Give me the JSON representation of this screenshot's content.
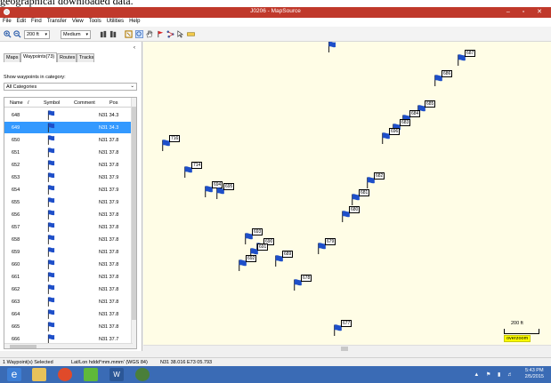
{
  "caption": "geographical downloaded data.",
  "window": {
    "title": "J0206 - MapSource"
  },
  "menu": [
    "File",
    "Edit",
    "Find",
    "Transfer",
    "View",
    "Tools",
    "Utilities",
    "Help"
  ],
  "toolbar": {
    "zoom_level": "200 ft",
    "detail": "Medium"
  },
  "tabs": [
    "Maps",
    "Waypoints(73)",
    "Routes",
    "Tracks"
  ],
  "panel": {
    "show_label": "Show waypoints in category:",
    "category": "All Categories",
    "columns": [
      "Name",
      "/",
      "Symbol",
      "Comment",
      "Pos"
    ]
  },
  "waypoints": [
    {
      "name": "648",
      "pos": "N31 34.3"
    },
    {
      "name": "649",
      "pos": "N31 34.3"
    },
    {
      "name": "650",
      "pos": "N31 37.8"
    },
    {
      "name": "651",
      "pos": "N31 37.8"
    },
    {
      "name": "652",
      "pos": "N31 37.8"
    },
    {
      "name": "653",
      "pos": "N31 37.9"
    },
    {
      "name": "654",
      "pos": "N31 37.9"
    },
    {
      "name": "655",
      "pos": "N31 37.9"
    },
    {
      "name": "656",
      "pos": "N31 37.8"
    },
    {
      "name": "657",
      "pos": "N31 37.8"
    },
    {
      "name": "658",
      "pos": "N31 37.8"
    },
    {
      "name": "659",
      "pos": "N31 37.8"
    },
    {
      "name": "660",
      "pos": "N31 37.8"
    },
    {
      "name": "661",
      "pos": "N31 37.8"
    },
    {
      "name": "662",
      "pos": "N31 37.8"
    },
    {
      "name": "663",
      "pos": "N31 37.8"
    },
    {
      "name": "664",
      "pos": "N31 37.8"
    },
    {
      "name": "665",
      "pos": "N31 37.8"
    },
    {
      "name": "666",
      "pos": "N31 37.7"
    }
  ],
  "selected_row": 1,
  "map_labels": [
    "687",
    "686",
    "685",
    "684",
    "683",
    "696",
    "716",
    "714",
    "694",
    "695",
    "682",
    "681",
    "680",
    "679",
    "693",
    "690",
    "691",
    "692",
    "689",
    "678",
    "677"
  ],
  "scale": {
    "label": "200 ft",
    "overzoom": "overzoom"
  },
  "status": {
    "selected": "1 Waypoint(s) Selected",
    "format": "Lat/Lon hddd°mm.mmm' (WGS 84)",
    "coords": "N31 38.016 E73 05.793"
  },
  "clock": {
    "time": "5:43 PM",
    "date": "2/5/2015"
  },
  "colors": {
    "titlebar": "#c0392b",
    "flag": "#1e4fc9",
    "selection": "#3399ff",
    "map_bg": "#fffde6",
    "taskbar": "#3a6bb5"
  }
}
